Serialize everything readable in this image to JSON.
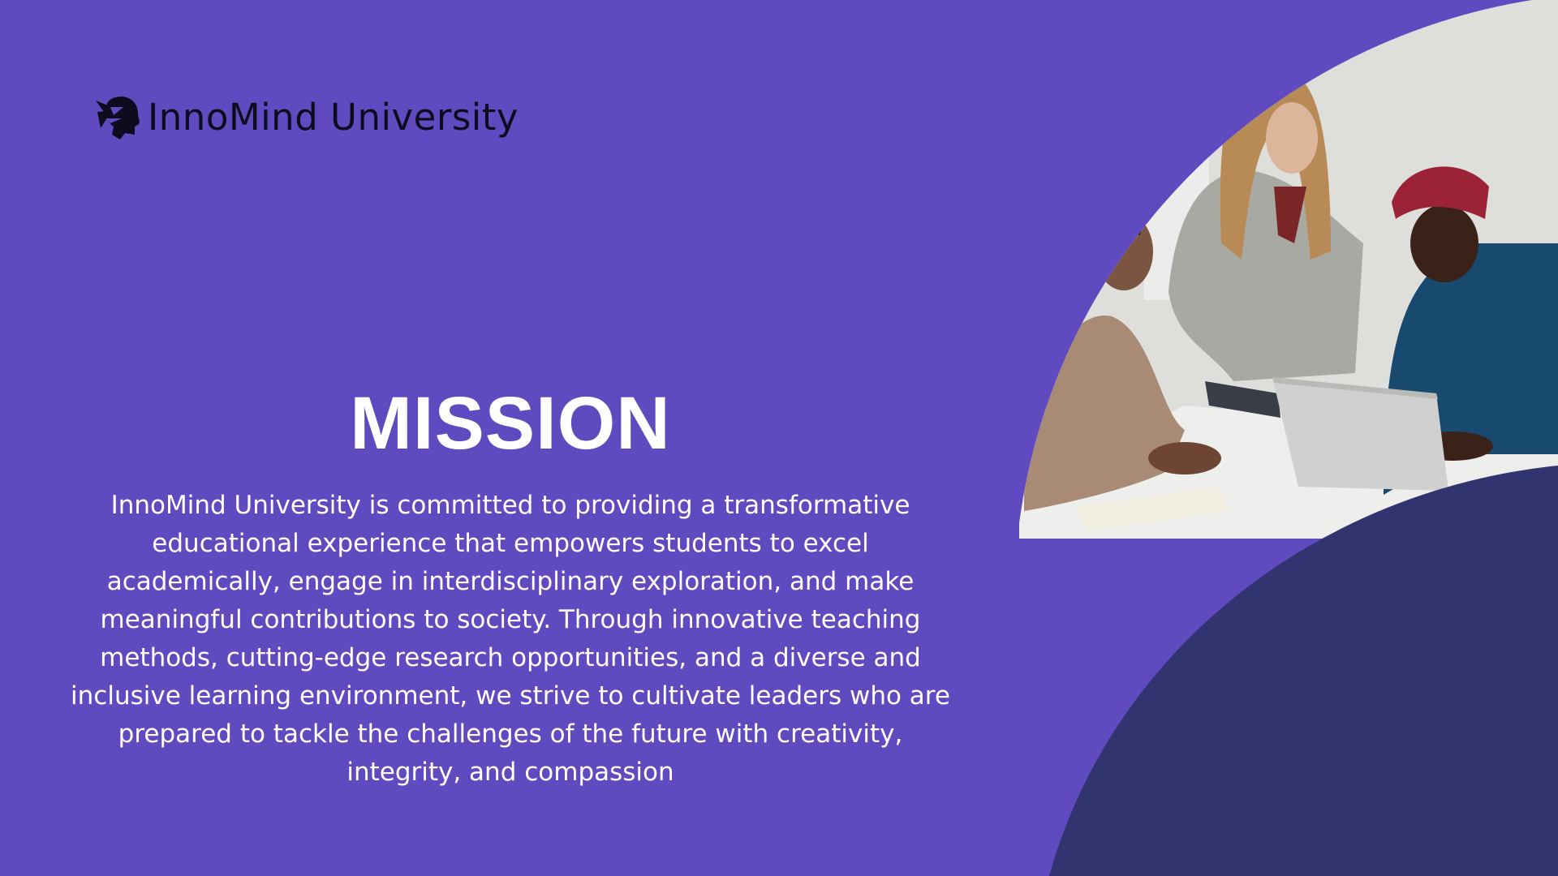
{
  "brand": {
    "name": "InnoMind University",
    "logo_icon": "head-with-origami-bird-icon"
  },
  "mission": {
    "title": "MISSION",
    "lines": [
      "InnoMind University is committed to providing a transformative",
      "educational experience that empowers students to excel",
      "academically, engage in interdisciplinary exploration, and make",
      "meaningful contributions to society. Through innovative teaching",
      "methods, cutting-edge research opportunities, and a diverse and",
      "inclusive learning environment, we strive to cultivate leaders who are",
      "prepared to tackle the challenges of the future with creativity,",
      "integrity, and compassion"
    ]
  },
  "photo": {
    "subject": "students-collaborating-photo"
  },
  "colors": {
    "background": "#5f4bbf",
    "accent_shape": "#31346f",
    "text": "#ffffff",
    "logo": "#0d0b1e"
  }
}
